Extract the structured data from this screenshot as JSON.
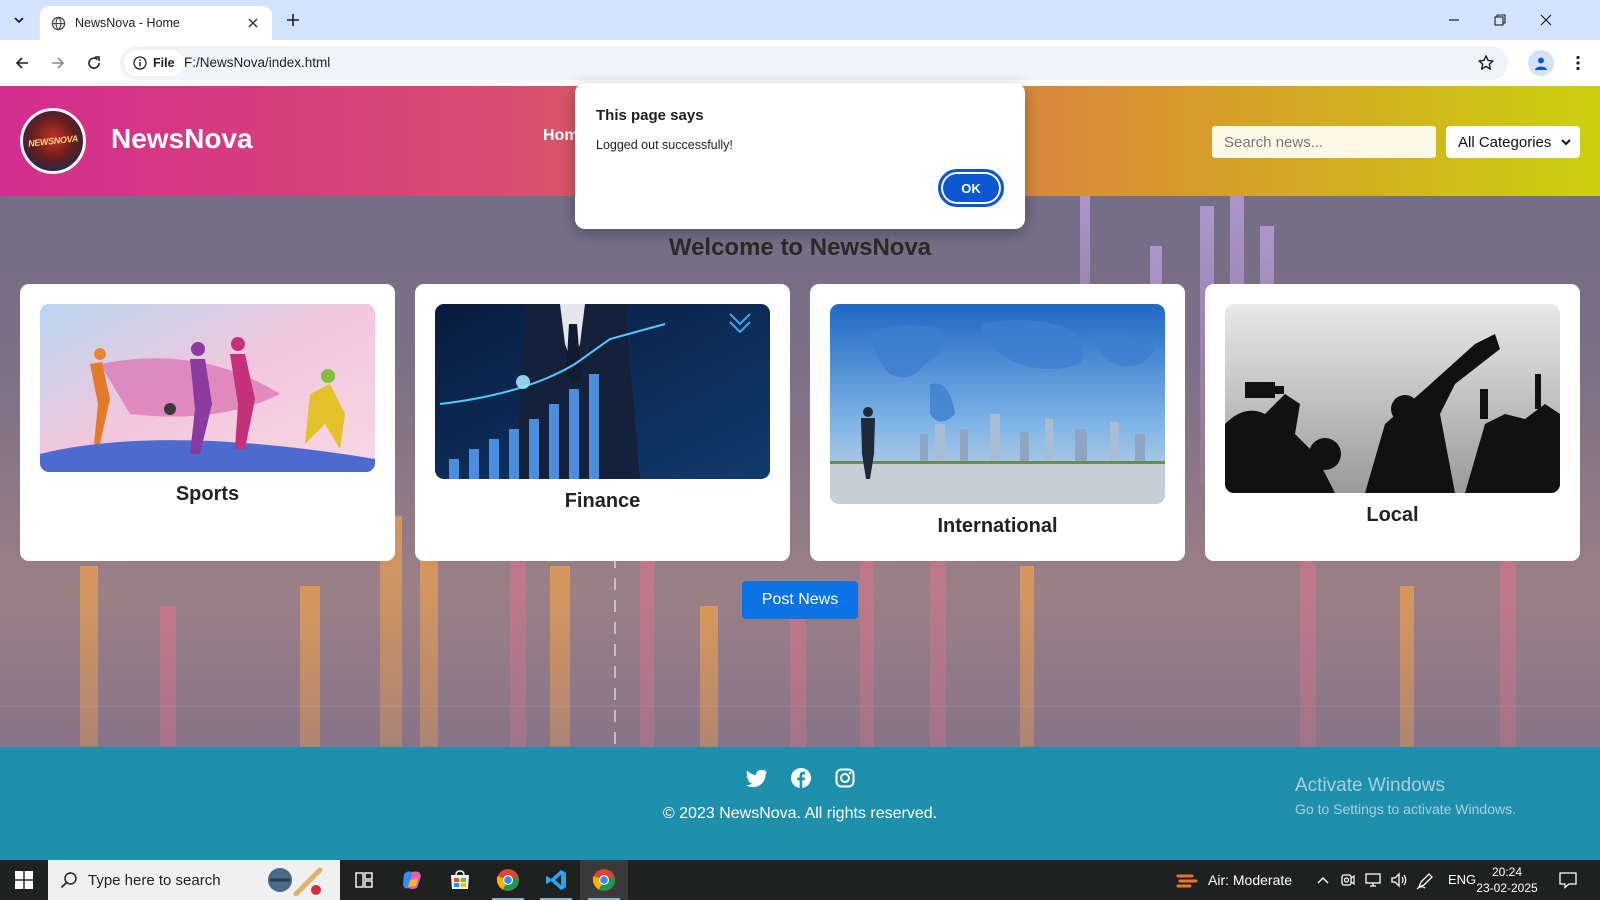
{
  "browser": {
    "tab_title": "NewsNova - Home",
    "site_chip_label": "File",
    "url": "F:/NewsNova/index.html"
  },
  "header": {
    "logo_text": "NEWSNOVA",
    "brand": "NewsNova",
    "nav_home": "Home",
    "search_placeholder": "Search news...",
    "category_selected": "All Categories"
  },
  "main": {
    "welcome": "Welcome to NewsNova",
    "cards": [
      {
        "label": "Sports",
        "image": "sports-collage"
      },
      {
        "label": "Finance",
        "image": "finance-growth-chart"
      },
      {
        "label": "International",
        "image": "world-map-city"
      },
      {
        "label": "Local",
        "image": "crowd-reporters"
      }
    ],
    "post_button": "Post News"
  },
  "footer": {
    "icons": [
      "twitter-icon",
      "facebook-icon",
      "instagram-icon"
    ],
    "copyright": "© 2023 NewsNova. All rights reserved.",
    "watermark_title": "Activate Windows",
    "watermark_sub": "Go to Settings to activate Windows."
  },
  "dialog": {
    "title": "This page says",
    "message": "Logged out successfully!",
    "ok_label": "OK"
  },
  "taskbar": {
    "search_placeholder": "Type here to search",
    "air_quality": "Air: Moderate",
    "language": "ENG",
    "time": "20:24",
    "date": "23-02-2025"
  },
  "colors": {
    "header_gradient": [
      "#d42d8f",
      "#d9735a",
      "#cbd00e"
    ],
    "footer": "#1e8fad",
    "post_button": "#0a74e6",
    "dialog_ok": "#0b57d0"
  }
}
